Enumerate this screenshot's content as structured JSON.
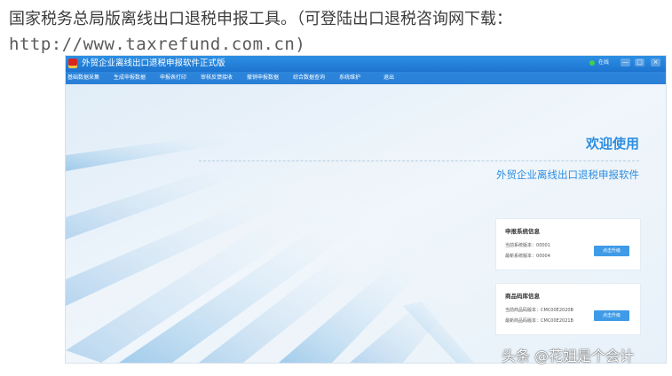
{
  "article": {
    "line1": "国家税务总局版离线出口退税申报工具。（可登陆出口退税咨询网下载：",
    "url": "http://www.taxrefund.com.cn)"
  },
  "app": {
    "title": "外贸企业离线出口退税申报软件正式版",
    "online_status": "在线",
    "window_buttons": {
      "minimize": "—",
      "maximize": "□",
      "close": "×"
    },
    "menu": [
      "基础数据采集",
      "生成申报数据",
      "申报表打印",
      "审核反馈接收",
      "撤销申报数据",
      "综合数据查询",
      "系统维护",
      "退出"
    ],
    "welcome": "欢迎使用",
    "subtitle": "外贸企业离线出口退税申报软件",
    "cards": [
      {
        "title": "申报系统信息",
        "current_label": "当前系统版本：",
        "current_value": "00001",
        "latest_label": "最新系统版本：",
        "latest_value": "00004",
        "button": "点击升级"
      },
      {
        "title": "商品码库信息",
        "current_label": "当前商品码版本：",
        "current_value": "CMC00E2020B",
        "latest_label": "最新商品码版本：",
        "latest_value": "CMC00E2021B",
        "button": "点击升级"
      }
    ]
  },
  "watermark": "头条 @花姐是个会计",
  "colors": {
    "titlebar": "#1d74cf",
    "accent": "#2e8ee0",
    "button": "#3f9be8"
  }
}
